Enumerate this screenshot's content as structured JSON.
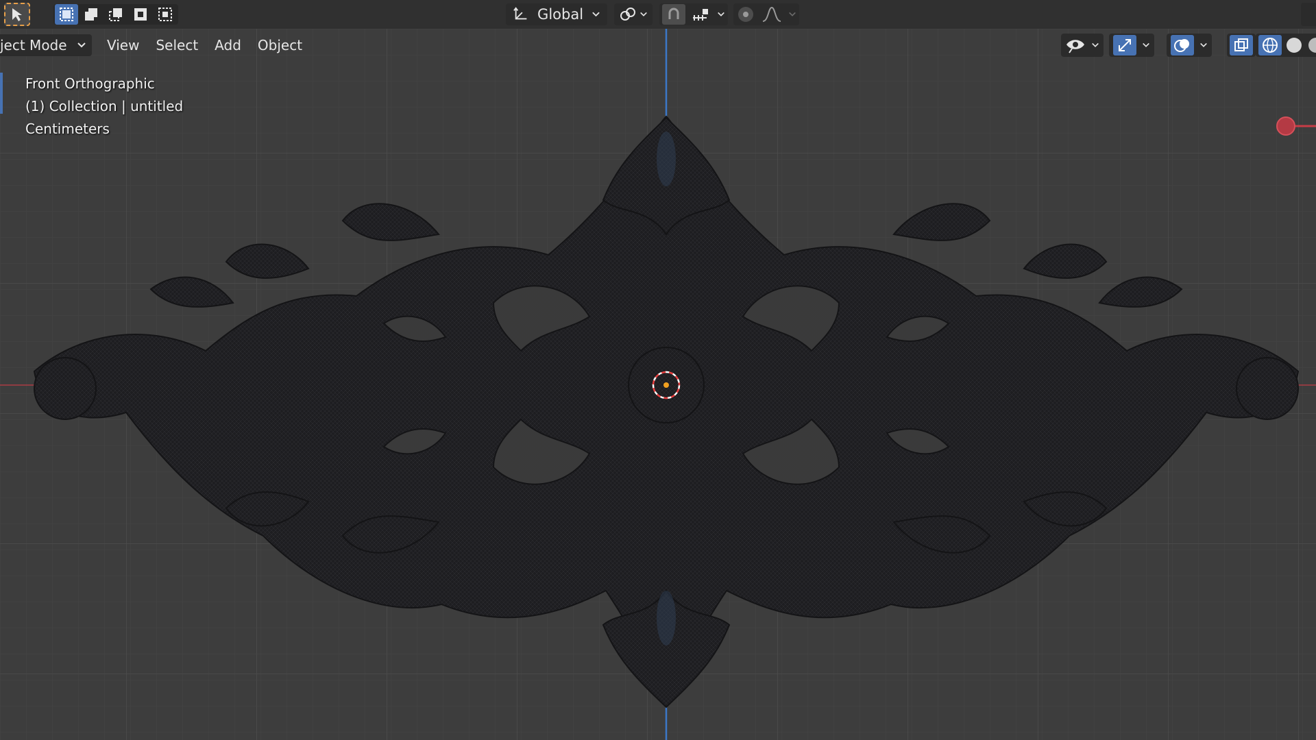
{
  "toolbar": {
    "transform_orientation": "Global",
    "select_tool_icon": "select-box-cursor-icon",
    "mode_icons": [
      "select-new-icon",
      "select-extend-icon",
      "select-subtract-icon",
      "select-invert-icon",
      "select-intersect-icon"
    ]
  },
  "viewport_header": {
    "mode": "ject Mode",
    "menus": [
      "View",
      "Select",
      "Add",
      "Object"
    ]
  },
  "overlay": {
    "view_name": "Front Orthographic",
    "collection": "(1) Collection | untitled",
    "units": "Centimeters"
  },
  "colors": {
    "x_axis": "#c83c46",
    "z_axis": "#3c78c8",
    "accent": "#4772b3",
    "cursor": "#e84040",
    "origin": "#f0a020",
    "mesh": "#1c1c1e"
  }
}
